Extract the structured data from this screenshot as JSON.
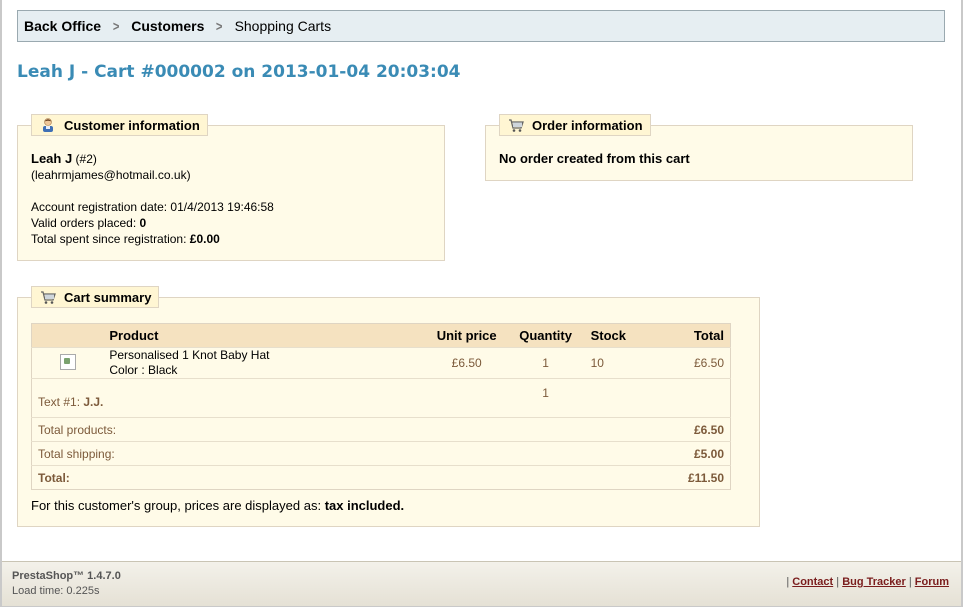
{
  "breadcrumb": {
    "items": [
      "Back Office",
      "Customers",
      "Shopping Carts"
    ]
  },
  "page_title": "Leah J - Cart #000002 on 2013-01-04 20:03:04",
  "customer_info": {
    "legend": "Customer information",
    "name": "Leah J",
    "id": "(#2)",
    "email": "(leahrmjames@hotmail.co.uk)",
    "registration_label": "Account registration date:",
    "registration_value": "01/4/2013 19:46:58",
    "orders_label": "Valid orders placed:",
    "orders_value": "0",
    "spent_label": "Total spent since registration:",
    "spent_value": "£0.00"
  },
  "order_info": {
    "legend": "Order information",
    "message": "No order created from this cart"
  },
  "cart_summary": {
    "legend": "Cart summary",
    "columns": {
      "product": "Product",
      "unit_price": "Unit price",
      "quantity": "Quantity",
      "stock": "Stock",
      "total": "Total"
    },
    "product": {
      "name": "Personalised 1 Knot Baby Hat",
      "attribute": "Color : Black",
      "unit_price": "£6.50",
      "quantity": "1",
      "stock": "10",
      "total": "£6.50"
    },
    "customization": {
      "label": "Text #1:",
      "value": "J.J.",
      "quantity": "1"
    },
    "totals": {
      "products_label": "Total products:",
      "products_value": "£6.50",
      "shipping_label": "Total shipping:",
      "shipping_value": "£5.00",
      "total_label": "Total:",
      "total_value": "£11.50"
    },
    "tax_note_prefix": "For this customer's group, prices are displayed as:",
    "tax_note_value": "tax included."
  },
  "footer": {
    "version": "PrestaShop™ 1.4.7.0",
    "load_time": "Load time: 0.225s",
    "links": {
      "contact": "Contact",
      "bug_tracker": "Bug Tracker",
      "forum": "Forum"
    }
  }
}
